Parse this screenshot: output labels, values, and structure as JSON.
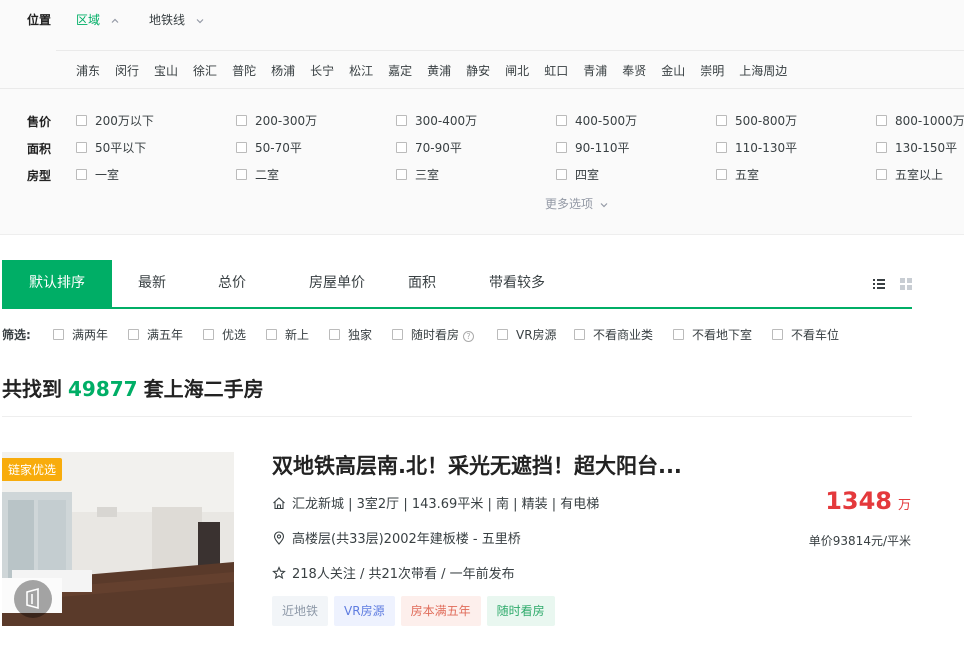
{
  "location": {
    "label": "位置",
    "tabs": [
      {
        "label": "区域",
        "active": true
      },
      {
        "label": "地铁线",
        "active": false
      }
    ],
    "districts": [
      "浦东",
      "闵行",
      "宝山",
      "徐汇",
      "普陀",
      "杨浦",
      "长宁",
      "松江",
      "嘉定",
      "黄浦",
      "静安",
      "闸北",
      "虹口",
      "青浦",
      "奉贤",
      "金山",
      "崇明",
      "上海周边"
    ]
  },
  "filters": [
    {
      "label": "售价",
      "options": [
        "200万以下",
        "200-300万",
        "300-400万",
        "400-500万",
        "500-800万",
        "800-1000万"
      ]
    },
    {
      "label": "面积",
      "options": [
        "50平以下",
        "50-70平",
        "70-90平",
        "90-110平",
        "110-130平",
        "130-150平"
      ]
    },
    {
      "label": "房型",
      "options": [
        "一室",
        "二室",
        "三室",
        "四室",
        "五室",
        "五室以上"
      ]
    }
  ],
  "more_options": "更多选项",
  "sort": {
    "tabs": [
      "默认排序",
      "最新",
      "总价",
      "房屋单价",
      "面积",
      "带看较多"
    ],
    "active_index": 0
  },
  "screen": {
    "label": "筛选:",
    "options": [
      "满两年",
      "满五年",
      "优选",
      "新上",
      "独家",
      "随时看房",
      "VR房源",
      "不看商业类",
      "不看地下室",
      "不看车位"
    ]
  },
  "total": {
    "prefix": "共找到",
    "count": "49877",
    "suffix": "套上海二手房"
  },
  "listing": {
    "badge": "链家优选",
    "title": "双地铁高层南.北！采光无遮挡！超大阳台...",
    "house_info": "汇龙新城 | 3室2厅 | 143.69平米 | 南 | 精装 | 有电梯",
    "position_info": "高楼层(共33层)2002年建板楼 - 五里桥",
    "follow_info": "218人关注 / 共21次带看 / 一年前发布",
    "total_price": "1348",
    "total_price_unit": "万",
    "unit_price": "单价93814元/平米",
    "tags": [
      "近地铁",
      "VR房源",
      "房本满五年",
      "随时看房"
    ]
  },
  "colors": {
    "accent": "#00ae66",
    "price": "#e4393c",
    "badge": "#f8ac0c"
  }
}
